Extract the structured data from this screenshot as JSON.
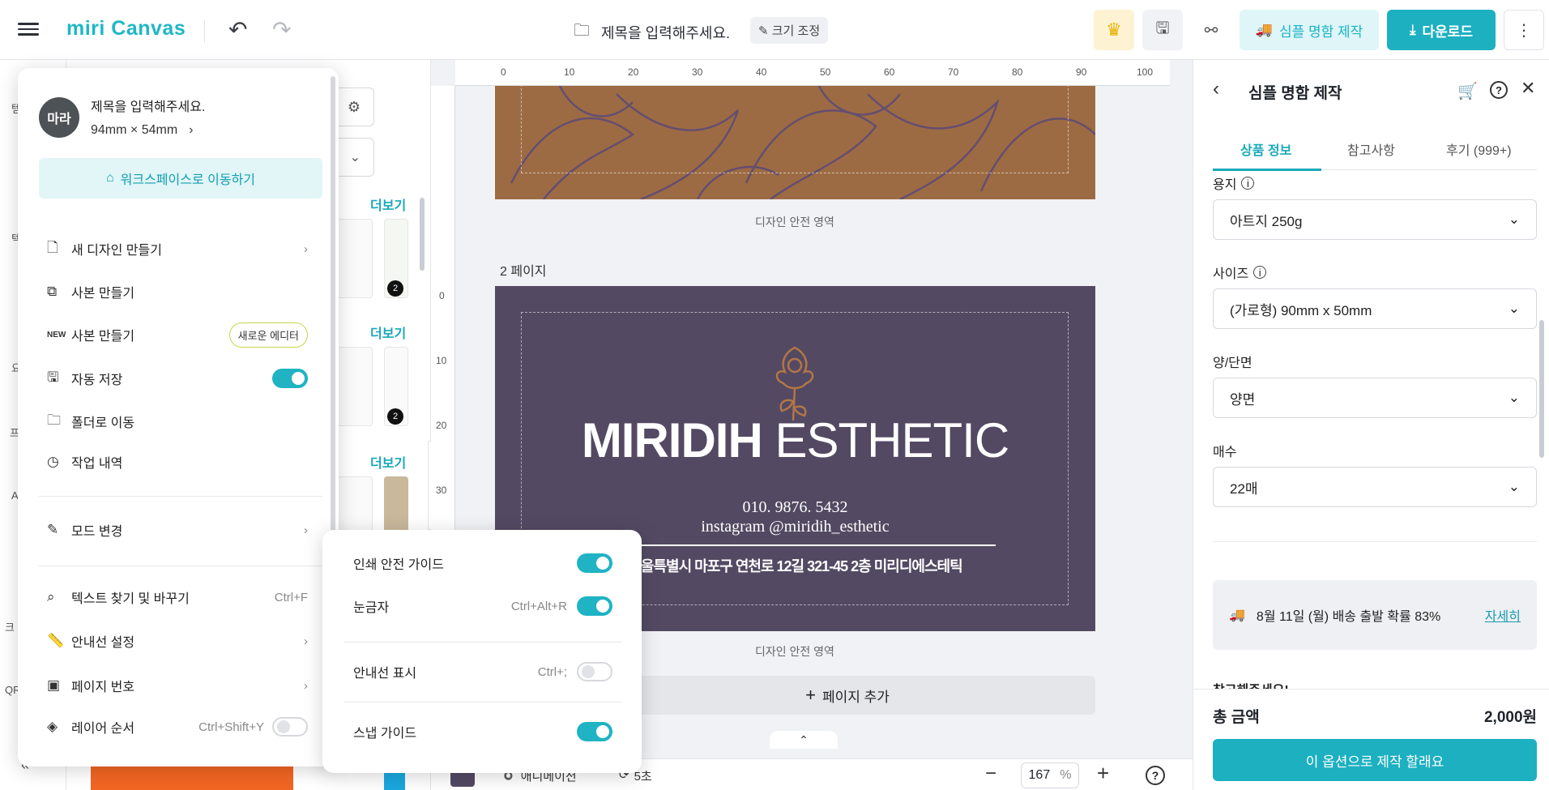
{
  "header": {
    "logo": "miri Canvas",
    "doc_title": "제목을 입력해주세요.",
    "resize_label": "크기 조정",
    "simple_card_label": "심플 명함 제작",
    "download_label": "다운로드"
  },
  "left_strip": [
    "템",
    "텍",
    "요",
    "프",
    "A",
    "크",
    "QR"
  ],
  "side_panel": {
    "more_labels": [
      "더보기",
      "더보기",
      "더보기"
    ],
    "badges": [
      "2",
      "2"
    ]
  },
  "menu": {
    "avatar": "마라",
    "doc_name": "제목을 입력해주세요.",
    "doc_size": "94mm × 54mm",
    "workspace_button": "워크스페이스로 이동하기",
    "items": [
      {
        "label": "새 디자인 만들기",
        "icon": "file-icon"
      },
      {
        "label": "사본 만들기",
        "icon": "copy-icon"
      },
      {
        "label": "사본 만들기",
        "icon": "new-icon",
        "badge": "새로운 에디터"
      },
      {
        "label": "자동 저장",
        "icon": "save-icon"
      },
      {
        "label": "폴더로 이동",
        "icon": "folder-move-icon"
      },
      {
        "label": "작업 내역",
        "icon": "history-icon"
      },
      {
        "label": "모드 변경",
        "icon": "mode-icon"
      },
      {
        "label": "텍스트 찾기 및 바꾸기",
        "icon": "search-icon",
        "shortcut": "Ctrl+F"
      },
      {
        "label": "안내선 설정",
        "icon": "ruler-icon"
      },
      {
        "label": "페이지 번호",
        "icon": "page-number-icon"
      },
      {
        "label": "레이어 순서",
        "icon": "layers-icon",
        "shortcut": "Ctrl+Shift+Y"
      }
    ],
    "auto_save": true
  },
  "submenu": {
    "items": [
      {
        "label": "인쇄 안전 가이드",
        "shortcut": "",
        "on": true
      },
      {
        "label": "눈금자",
        "shortcut": "Ctrl+Alt+R",
        "on": true
      },
      {
        "label": "안내선 표시",
        "shortcut": "Ctrl+;",
        "on": false
      },
      {
        "label": "스냅 가이드",
        "shortcut": "",
        "on": true
      }
    ]
  },
  "canvas": {
    "ruler_top": [
      "0",
      "10",
      "20",
      "30",
      "40",
      "50",
      "60",
      "70",
      "80",
      "90",
      "100"
    ],
    "ruler_left": [
      "0",
      "10",
      "20",
      "30"
    ],
    "safe_area_label": "디자인 안전 영역",
    "page2_label": "2 페이지",
    "card": {
      "brand_bold": "MIRIDIH",
      "brand_light": "ESTHETIC",
      "phone": "010. 9876. 5432",
      "instagram": "instagram @miridih_esthetic",
      "address": "서울특별시 마포구 연천로 12길 321-45 2층 미리디에스테틱"
    },
    "add_page": "페이지 추가",
    "animation_label": "애니메이션",
    "duration": "5초",
    "zoom": "167",
    "zoom_unit": "%"
  },
  "right_panel": {
    "title": "심플 명함 제작",
    "tabs": [
      "상품 정보",
      "참고사항",
      "후기 (999+)"
    ],
    "fields": [
      {
        "label": "용지",
        "value": "아트지 250g",
        "info": true
      },
      {
        "label": "사이즈",
        "value": "(가로형) 90mm x 50mm",
        "info": true
      },
      {
        "label": "양/단면",
        "value": "양면",
        "info": false
      },
      {
        "label": "매수",
        "value": "22매",
        "info": false
      }
    ],
    "delivery_text": "8월 11일 (월) 배송 출발 확률 83%",
    "delivery_link": "자세히",
    "note_cut": "참고해주세요!",
    "total_label": "총 금액",
    "total_value": "2,000원",
    "make_button": "이 옵션으로 제작 할래요"
  },
  "colors": {
    "accent": "#1cb0c1",
    "card1": "#9d6b43",
    "card2": "#544963"
  }
}
